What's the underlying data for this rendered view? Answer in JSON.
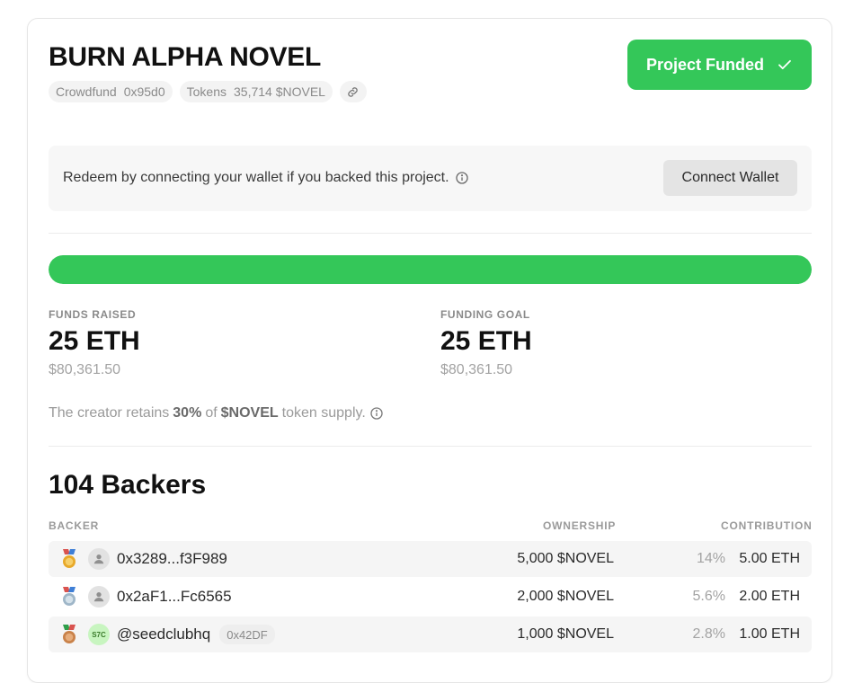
{
  "project": {
    "title": "BURN ALPHA NOVEL",
    "pills": {
      "type_label": "Crowdfund",
      "type_value": "0x95d0",
      "tokens_label": "Tokens",
      "tokens_value": "35,714 $NOVEL"
    },
    "status_button": "Project Funded"
  },
  "redeem": {
    "text": "Redeem by connecting your wallet if you backed this project.",
    "button": "Connect Wallet"
  },
  "progress": {
    "fraction": 1.0,
    "color": "#34c759"
  },
  "stats": {
    "raised": {
      "label": "FUNDS RAISED",
      "value": "25 ETH",
      "usd": "$80,361.50"
    },
    "goal": {
      "label": "FUNDING GOAL",
      "value": "25 ETH",
      "usd": "$80,361.50"
    }
  },
  "retain": {
    "pre": "The creator retains",
    "pct": "30%",
    "mid": "of",
    "token": "$NOVEL",
    "post": "token supply."
  },
  "backers": {
    "title": "104 Backers",
    "headers": {
      "backer": "BACKER",
      "ownership": "OWNERSHIP",
      "contribution": "CONTRIBUTION"
    },
    "rows": [
      {
        "medal": "gold",
        "avatar": "user-icon",
        "name": "0x3289...f3F989",
        "tag": "",
        "ownership": "5,000 $NOVEL",
        "pct": "14%",
        "contribution": "5.00 ETH"
      },
      {
        "medal": "silver",
        "avatar": "user-icon",
        "name": "0x2aF1...Fc6565",
        "tag": "",
        "ownership": "2,000 $NOVEL",
        "pct": "5.6%",
        "contribution": "2.00 ETH"
      },
      {
        "medal": "bronze",
        "avatar": "S7C",
        "name": "@seedclubhq",
        "tag": "0x42DF",
        "ownership": "1,000 $NOVEL",
        "pct": "2.8%",
        "contribution": "1.00 ETH"
      }
    ]
  },
  "colors": {
    "accent": "#34c759",
    "gold": "#e8a92a",
    "silver": "#9fb6c8",
    "bronze": "#c9824a"
  }
}
